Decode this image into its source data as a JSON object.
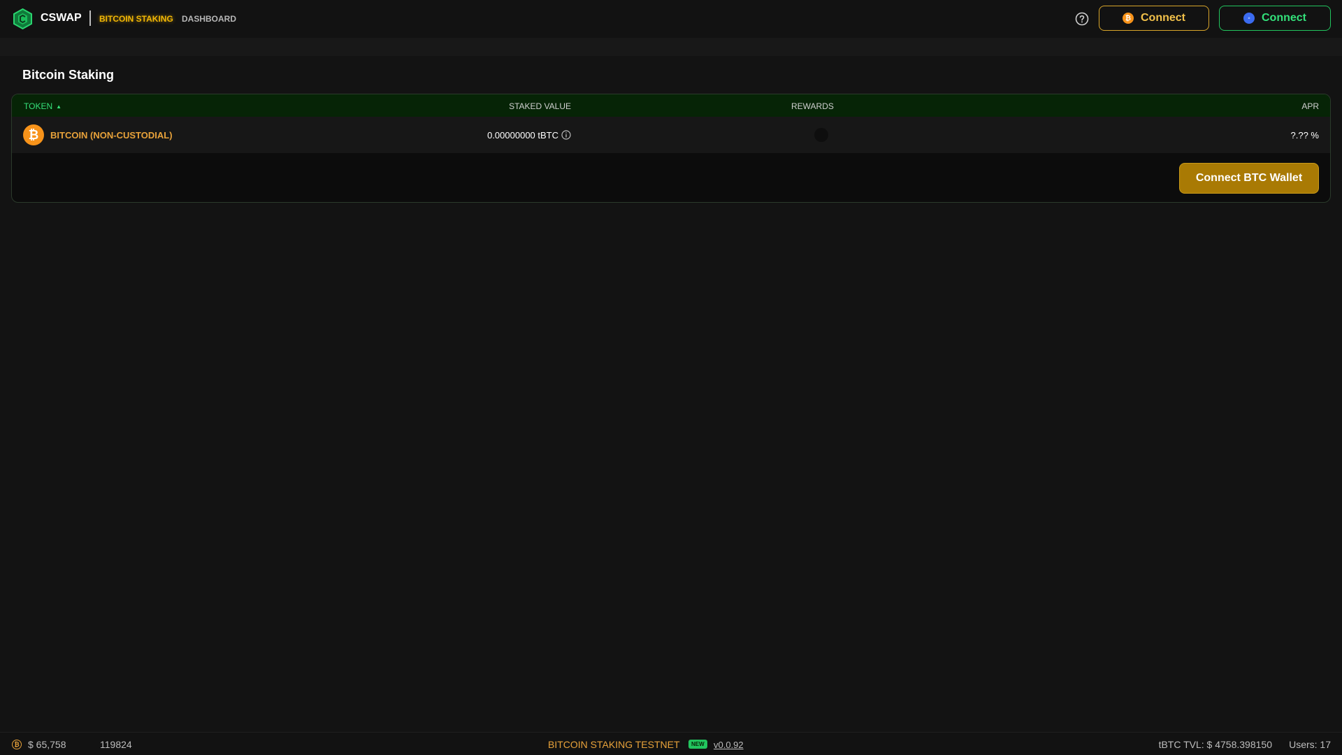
{
  "header": {
    "brand": "CSWAP",
    "nav": [
      {
        "label": "BITCOIN STAKING",
        "active": true
      },
      {
        "label": "DASHBOARD",
        "active": false
      }
    ],
    "icons": {
      "logo": "cswap-hexagon-logo",
      "help": "question-circle-icon"
    },
    "connect_btc": {
      "label": "Connect",
      "icon": "bitcoin-coin-icon",
      "color": "#d8a52a"
    },
    "connect_stx": {
      "label": "Connect",
      "icon": "stacks-coin-icon",
      "color": "#22c55e"
    }
  },
  "main": {
    "title": "Bitcoin Staking",
    "table": {
      "columns": {
        "token": "TOKEN",
        "staked": "STAKED VALUE",
        "rewards": "REWARDS",
        "apr": "APR"
      },
      "rows": [
        {
          "token": "BITCOIN (NON-CUSTODIAL)",
          "staked": "0.00000000 tBTC",
          "rewards": "",
          "apr": "?.?? %"
        }
      ]
    },
    "wallet_button": "Connect BTC Wallet"
  },
  "footer": {
    "btc_price": "$ 65,758",
    "block_height": "119824",
    "network": "BITCOIN STAKING TESTNET",
    "badge": "NEW",
    "version": "v0.0.92",
    "tvl": "tBTC TVL: $ 4758.398150",
    "users": "Users: 17"
  },
  "colors": {
    "accent_gold": "#f2b705",
    "accent_green": "#22c55e",
    "background": "#131313"
  }
}
